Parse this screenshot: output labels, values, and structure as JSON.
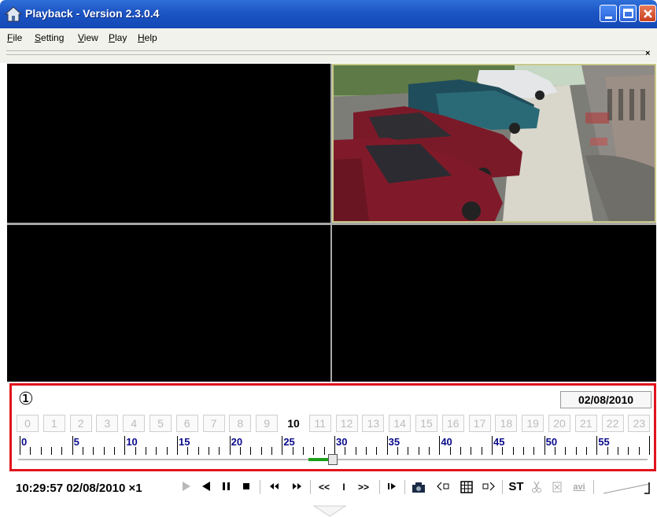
{
  "window": {
    "title": "Playback - Version 2.3.0.4",
    "icon": "house-icon",
    "controls": [
      "minimize-icon",
      "maximize-icon",
      "close-icon"
    ],
    "title_bar_color": "#1c55c4"
  },
  "menu": {
    "items": [
      {
        "key": "F",
        "rest": "ile"
      },
      {
        "key": "S",
        "rest": "etting"
      },
      {
        "key": "V",
        "rest": "iew"
      },
      {
        "key": "P",
        "rest": "lay"
      },
      {
        "key": "H",
        "rest": "elp"
      }
    ],
    "close_glyph": "×"
  },
  "video": {
    "layout": "2x2",
    "active_channel": 2,
    "active_content": "parking-lot-camera-image"
  },
  "timeline": {
    "marker": "①",
    "date": "02/08/2010",
    "hours": [
      "0",
      "1",
      "2",
      "3",
      "4",
      "5",
      "6",
      "7",
      "8",
      "9",
      "10",
      "11",
      "12",
      "13",
      "14",
      "15",
      "16",
      "17",
      "18",
      "19",
      "20",
      "21",
      "22",
      "23"
    ],
    "active_hour": "10",
    "minute_labels": [
      "0",
      "5",
      "10",
      "15",
      "20",
      "25",
      "30",
      "35",
      "40",
      "45",
      "50",
      "55"
    ],
    "position_minutes": 29.9,
    "highlight_color": "#e0141c"
  },
  "controls": {
    "timestamp": "10:29:57 02/08/2010 ×1",
    "st_label": "ST",
    "avi_label": "avi",
    "step_back_label": "<<",
    "step_fwd_label": ">>",
    "mark_label": "I",
    "buttons": [
      "play-icon",
      "reverse-play-icon",
      "pause-icon",
      "stop-icon",
      "slow-icon",
      "fast-icon",
      "step-back-button",
      "mark-button",
      "step-forward-button",
      "frame-step-icon",
      "snapshot-icon",
      "audio-prev-icon",
      "grid-icon",
      "audio-next-icon",
      "st-button",
      "cut-icon",
      "delete-icon",
      "avi-button",
      "volume-slider"
    ]
  }
}
